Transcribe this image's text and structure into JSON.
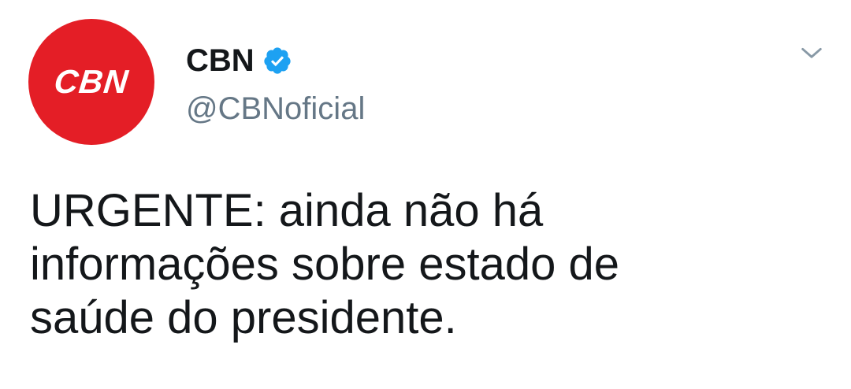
{
  "tweet": {
    "avatar": {
      "logo_text": "CBN",
      "background_color": "#e41e26",
      "icon": "cbn-logo"
    },
    "author": {
      "display_name": "CBN",
      "verified": true,
      "verified_icon": "verified-badge-icon",
      "verified_color": "#1da1f2",
      "handle": "@CBNoficial"
    },
    "menu_icon": "chevron-down-icon",
    "text": "URGENTE: ainda não há\ninformações sobre estado de\nsaúde do presidente."
  }
}
